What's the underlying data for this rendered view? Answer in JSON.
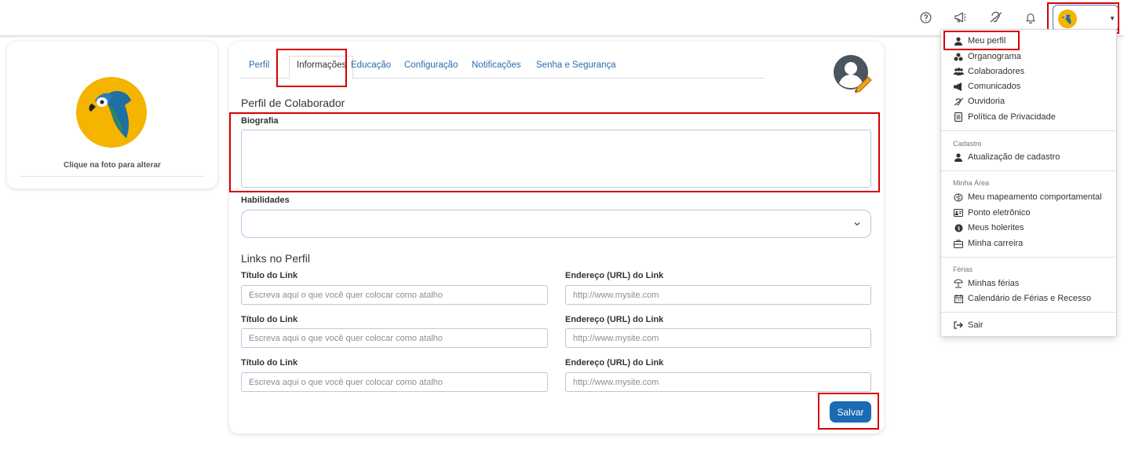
{
  "profile_tabs": [
    {
      "label": "Perfil"
    },
    {
      "label": "Informações"
    },
    {
      "label": "Educação"
    },
    {
      "label": "Configuração"
    },
    {
      "label": "Notificações"
    },
    {
      "label": "Senha e Segurança"
    }
  ],
  "left_card": {
    "caption": "Clique na foto para alterar"
  },
  "form": {
    "section_title": "Perfil de Colaborador",
    "bio_label": "Biografia",
    "bio_value": "",
    "skills_label": "Habilidades",
    "links_title": "Links no Perfil",
    "link_title_label": "Título do Link",
    "link_url_label": "Endereço (URL) do Link",
    "link_title_placeholder": "Escreva aqui o que você quer colocar como atalho",
    "link_url_placeholder": "http://www.mysite.com",
    "save_label": "Salvar"
  },
  "menu": {
    "items_top": [
      {
        "label": "Meu perfil",
        "icon": "user-icon"
      },
      {
        "label": "Organograma",
        "icon": "sitemap-icon"
      },
      {
        "label": "Colaboradores",
        "icon": "users-icon"
      },
      {
        "label": "Comunicados",
        "icon": "megaphone-icon"
      },
      {
        "label": "Ouvidoria",
        "icon": "ear-icon"
      },
      {
        "label": "Política de Privacidade",
        "icon": "document-icon"
      }
    ],
    "cadastro_header": "Cadastro",
    "cadastro_items": [
      {
        "label": "Atualização de cadastro",
        "icon": "user-icon"
      }
    ],
    "minha_area_header": "Minha Área",
    "minha_area_items": [
      {
        "label": "Meu mapeamento comportamental",
        "icon": "brain-icon"
      },
      {
        "label": "Ponto eletrônico",
        "icon": "id-card-icon"
      },
      {
        "label": "Meus holerites",
        "icon": "money-icon"
      },
      {
        "label": "Minha carreira",
        "icon": "briefcase-icon"
      }
    ],
    "ferias_header": "Férias",
    "ferias_items": [
      {
        "label": "Minhas férias",
        "icon": "umbrella-beach-icon"
      },
      {
        "label": "Calendário de Férias e Recesso",
        "icon": "calendar-icon"
      }
    ],
    "logout": {
      "label": "Sair",
      "icon": "sign-out-icon"
    }
  },
  "colors": {
    "primary": "#1a6ab4",
    "link": "#2b6cb0",
    "highlight": "#d60000",
    "avatar_bg": "#f4b400"
  }
}
